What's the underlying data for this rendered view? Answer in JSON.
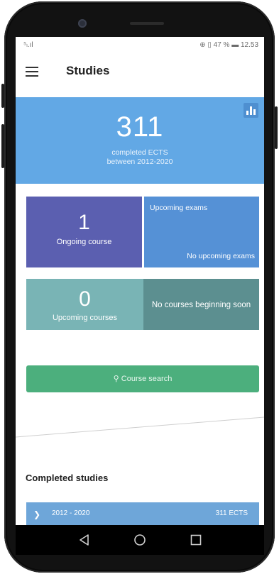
{
  "status_bar": {
    "signal": "⁵ₗ.ıl",
    "right": "⊕ ▯ 47 % ▬ 12.53"
  },
  "app_bar": {
    "menu_icon": "hamburger-menu-icon",
    "title": "Studies"
  },
  "summary": {
    "credits": "311",
    "line1": "completed ECTS",
    "line2": "between 2012-2020",
    "chart_icon": "bar-chart-icon"
  },
  "tiles": {
    "ongoing": {
      "count": "1",
      "label": "Ongoing course"
    },
    "exams": {
      "title": "Upcoming exams",
      "empty": "No upcoming exams"
    },
    "upcoming": {
      "count": "0",
      "label": "Upcoming courses"
    },
    "no_upcoming": {
      "label": "No courses beginning soon"
    }
  },
  "search": {
    "icon": "search-icon",
    "label": "Course search"
  },
  "completed": {
    "title": "Completed studies",
    "rows": [
      {
        "years": "2012 - 2020",
        "credits": "311 ECTS"
      }
    ]
  },
  "colors": {
    "hero": "#62a8e5",
    "ongoing": "#5b5fb0",
    "exams": "#5591d6",
    "upcoming": "#79b4b5",
    "no_upcoming": "#5c8f90",
    "search": "#4caf7d"
  },
  "navbar": {
    "back_icon": "back-triangle-icon",
    "home_icon": "home-circle-icon",
    "recents_icon": "recents-square-icon"
  }
}
